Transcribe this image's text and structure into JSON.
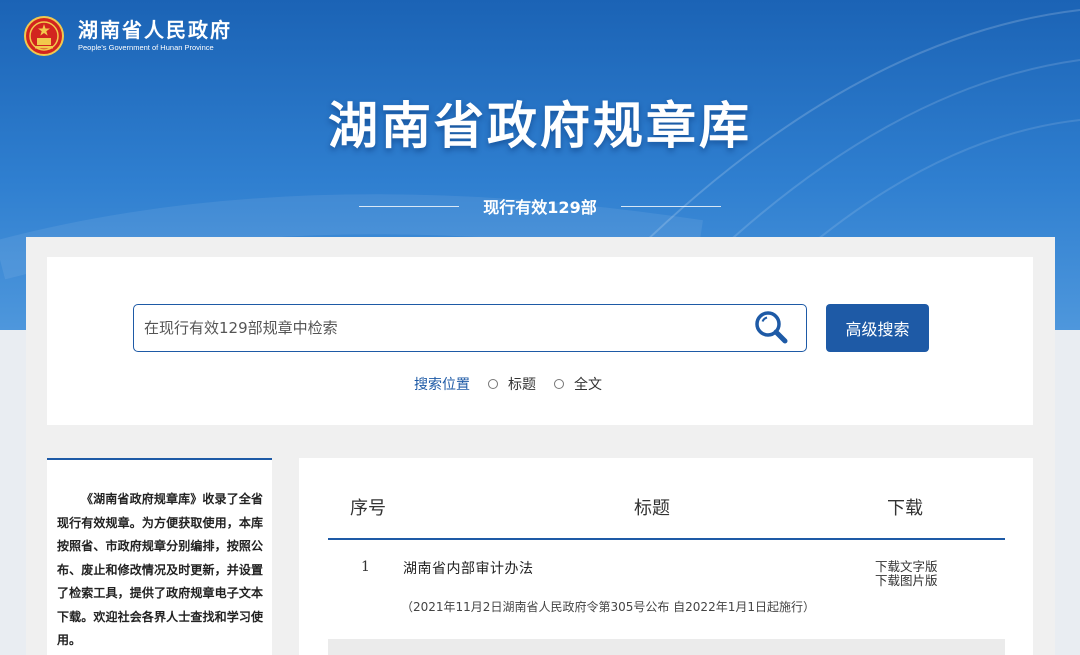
{
  "header": {
    "site_name": "湖南省人民政府",
    "site_name_en": "People's Government of Hunan Province",
    "main_title": "湖南省政府规章库",
    "subtitle": "现行有效129部"
  },
  "search": {
    "placeholder": "在现行有效129部规章中检索",
    "value": "",
    "advanced_label": "高级搜索",
    "scope_label": "搜索位置",
    "scope_options": [
      "标题",
      "全文"
    ]
  },
  "intro": {
    "text": "《湖南省政府规章库》收录了全省现行有效规章。为方便获取使用，本库按照省、市政府规章分别编排，按照公布、废止和修改情况及时更新，并设置了检索工具，提供了政府规章电子文本下载。欢迎社会各界人士查找和学习使用。"
  },
  "table": {
    "headers": [
      "序号",
      "标题",
      "下载"
    ],
    "rows": [
      {
        "num": "1",
        "title": "湖南省内部审计办法",
        "meta": "（2021年11月2日湖南省人民政府令第305号公布 自2022年1月1日起施行）",
        "download_text": "下载文字版",
        "download_image": "下载图片版"
      }
    ]
  },
  "colors": {
    "primary": "#1e5aa6",
    "banner_top": "#1b63b5",
    "banner_bottom": "#4e97dc"
  },
  "icons": [
    "national-emblem-icon",
    "search-icon",
    "radio-icon"
  ]
}
